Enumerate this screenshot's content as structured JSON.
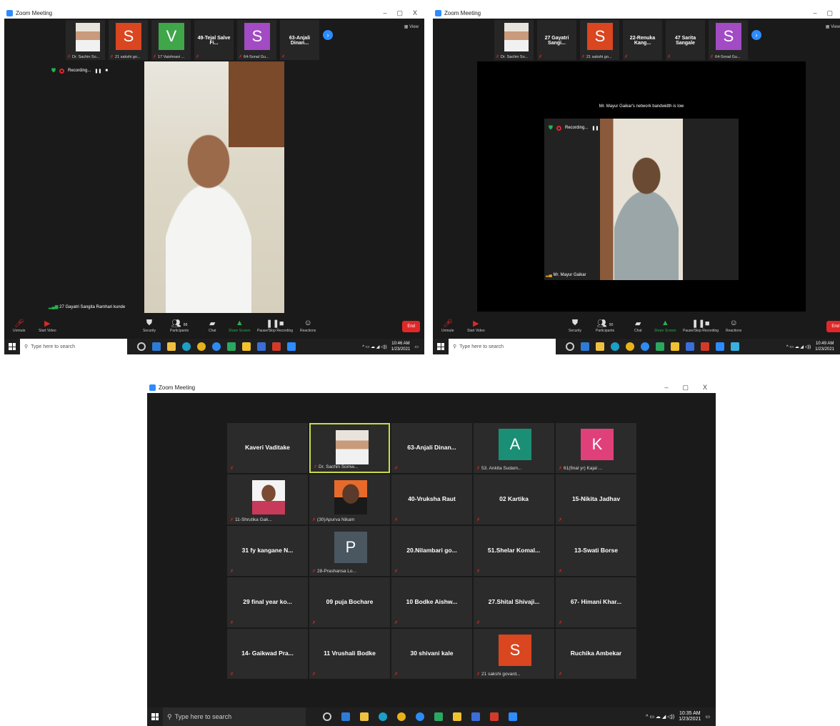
{
  "window_title": "Zoom Meeting",
  "window_controls": [
    "–",
    "▢",
    "X"
  ],
  "view_label": "View",
  "recording_label": "Recording...",
  "controls": {
    "unmute": "Unmute",
    "start_video": "Start Video",
    "security": "Security",
    "participants": "Participants",
    "participants_count_a": "88",
    "participants_count_b": "90",
    "chat": "Chat",
    "share_screen": "Share Screen",
    "pause_recording": "Pause/Stop Recording",
    "reactions": "Reactions",
    "end": "End"
  },
  "taskbar": {
    "search_placeholder": "Type here to search",
    "time_a": "10:46 AM",
    "time_b": "10:49 AM",
    "time_c": "10:35 AM",
    "date": "1/23/2021"
  },
  "screenshot1": {
    "thumbs": [
      {
        "type": "photo",
        "label": "Dr. Sachin So..."
      },
      {
        "type": "letter",
        "letter": "S",
        "color": "#d9461f",
        "label": "21 sakshi go..."
      },
      {
        "type": "letter",
        "letter": "V",
        "color": "#3fa64a",
        "label": "17 Vaishnavi ..."
      },
      {
        "type": "name",
        "name": "49-Tejal Salve Fi..."
      },
      {
        "type": "letter",
        "letter": "S",
        "color": "#a24bc4",
        "label": "64-Sonal Gu..."
      },
      {
        "type": "name",
        "name": "63-Anjali Dinan..."
      }
    ],
    "speaker_label": "27 Gayatri Sangita Ramhari kunde"
  },
  "screenshot2": {
    "thumbs": [
      {
        "type": "photo",
        "label": "Dr. Sachin So..."
      },
      {
        "type": "name",
        "name": "27 Gayatri Sangi..."
      },
      {
        "type": "letter",
        "letter": "S",
        "color": "#d9461f",
        "label": "21 sakshi go..."
      },
      {
        "type": "name",
        "name": "22-Renuka Kang..."
      },
      {
        "type": "name",
        "name": "47 Sarita Sangale"
      },
      {
        "type": "letter",
        "letter": "S",
        "color": "#a24bc4",
        "label": "64-Sonal Gu..."
      }
    ],
    "bandwidth_notice": "Mr. Mayur Gaikar's network bandwidth is low",
    "speaker_label": "Mr. Mayur Gaikar"
  },
  "screenshot3": {
    "tiles": [
      {
        "type": "name",
        "name": "Kaveri Vaditake"
      },
      {
        "type": "photo",
        "label": "Dr. Sachin Somw...",
        "active": true
      },
      {
        "type": "name",
        "name": "63-Anjali  Dinan..."
      },
      {
        "type": "letter",
        "letter": "A",
        "color": "#1b8f75",
        "label": "53. Ankita Sudam..."
      },
      {
        "type": "letter",
        "letter": "K",
        "color": "#e0407a",
        "label": "61(final yr) Kajal ..."
      },
      {
        "type": "photo2",
        "label": "11-Shrutika Gak..."
      },
      {
        "type": "photo3",
        "label": "(30)Apurva Nikam"
      },
      {
        "type": "name",
        "name": "40-Vruksha Raut"
      },
      {
        "type": "name",
        "name": "02 Kartika"
      },
      {
        "type": "name",
        "name": "15-Nikita Jadhav"
      },
      {
        "type": "name",
        "name": "31 fy kangane N..."
      },
      {
        "type": "letter",
        "letter": "P",
        "color": "#4a5660",
        "label": "28-Prashansa Lo..."
      },
      {
        "type": "name",
        "name": "20.Nilambari  go..."
      },
      {
        "type": "name",
        "name": "51.Shelar  Komal..."
      },
      {
        "type": "name",
        "name": "13-Swati Borse"
      },
      {
        "type": "name",
        "name": "29 final year ko..."
      },
      {
        "type": "name",
        "name": "09 puja Bochare"
      },
      {
        "type": "name",
        "name": "10 Bodke Aishw..."
      },
      {
        "type": "name",
        "name": "27.Shital  Shivaji..."
      },
      {
        "type": "name",
        "name": "67- Himani Khar..."
      },
      {
        "type": "name",
        "name": "14- Gaikwad Pra..."
      },
      {
        "type": "name",
        "name": "11 Vrushali Bodke"
      },
      {
        "type": "name",
        "name": "30 shivani kale"
      },
      {
        "type": "letter",
        "letter": "S",
        "color": "#d9461f",
        "label": "21 sakshi govard..."
      },
      {
        "type": "name",
        "name": "Ruchika Ambekar"
      }
    ]
  }
}
